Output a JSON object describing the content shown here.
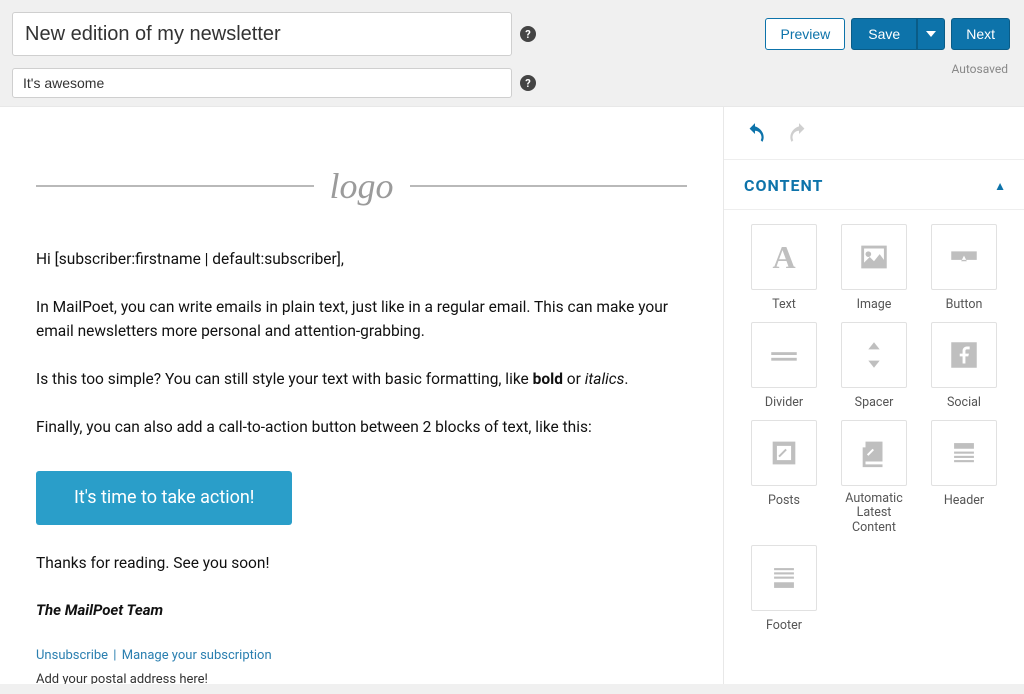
{
  "header": {
    "subject": "New edition of my newsletter",
    "preheader": "It's awesome",
    "preview": "Preview",
    "save": "Save",
    "next": "Next",
    "autosaved": "Autosaved"
  },
  "editor": {
    "logo": "logo",
    "greeting": "Hi [subscriber:firstname | default:subscriber],",
    "para_intro_before": "In MailPoet, you can write emails in plain text, just like in a regular email. This can make your email newsletters more personal and attention-grabbing.",
    "para_format_prefix": "Is this too simple? You can still style your text with basic formatting, like ",
    "format_bold": "bold",
    "format_or": " or ",
    "format_italic": "italics",
    "format_period": ".",
    "para_cta": "Finally, you can also add a call-to-action button between 2 blocks of text, like this:",
    "cta_label": "It's time to take action!",
    "outro": "Thanks for reading. See you soon!",
    "signature": "The MailPoet Team",
    "unsubscribe": "Unsubscribe",
    "manage": "Manage your subscription",
    "postal": "Add your postal address here!"
  },
  "sidebar": {
    "panel_title": "CONTENT",
    "blocks": {
      "text": "Text",
      "image": "Image",
      "button": "Button",
      "divider": "Divider",
      "spacer": "Spacer",
      "social": "Social",
      "posts": "Posts",
      "alc": "Automatic Latest Content",
      "header": "Header",
      "footer": "Footer"
    }
  }
}
